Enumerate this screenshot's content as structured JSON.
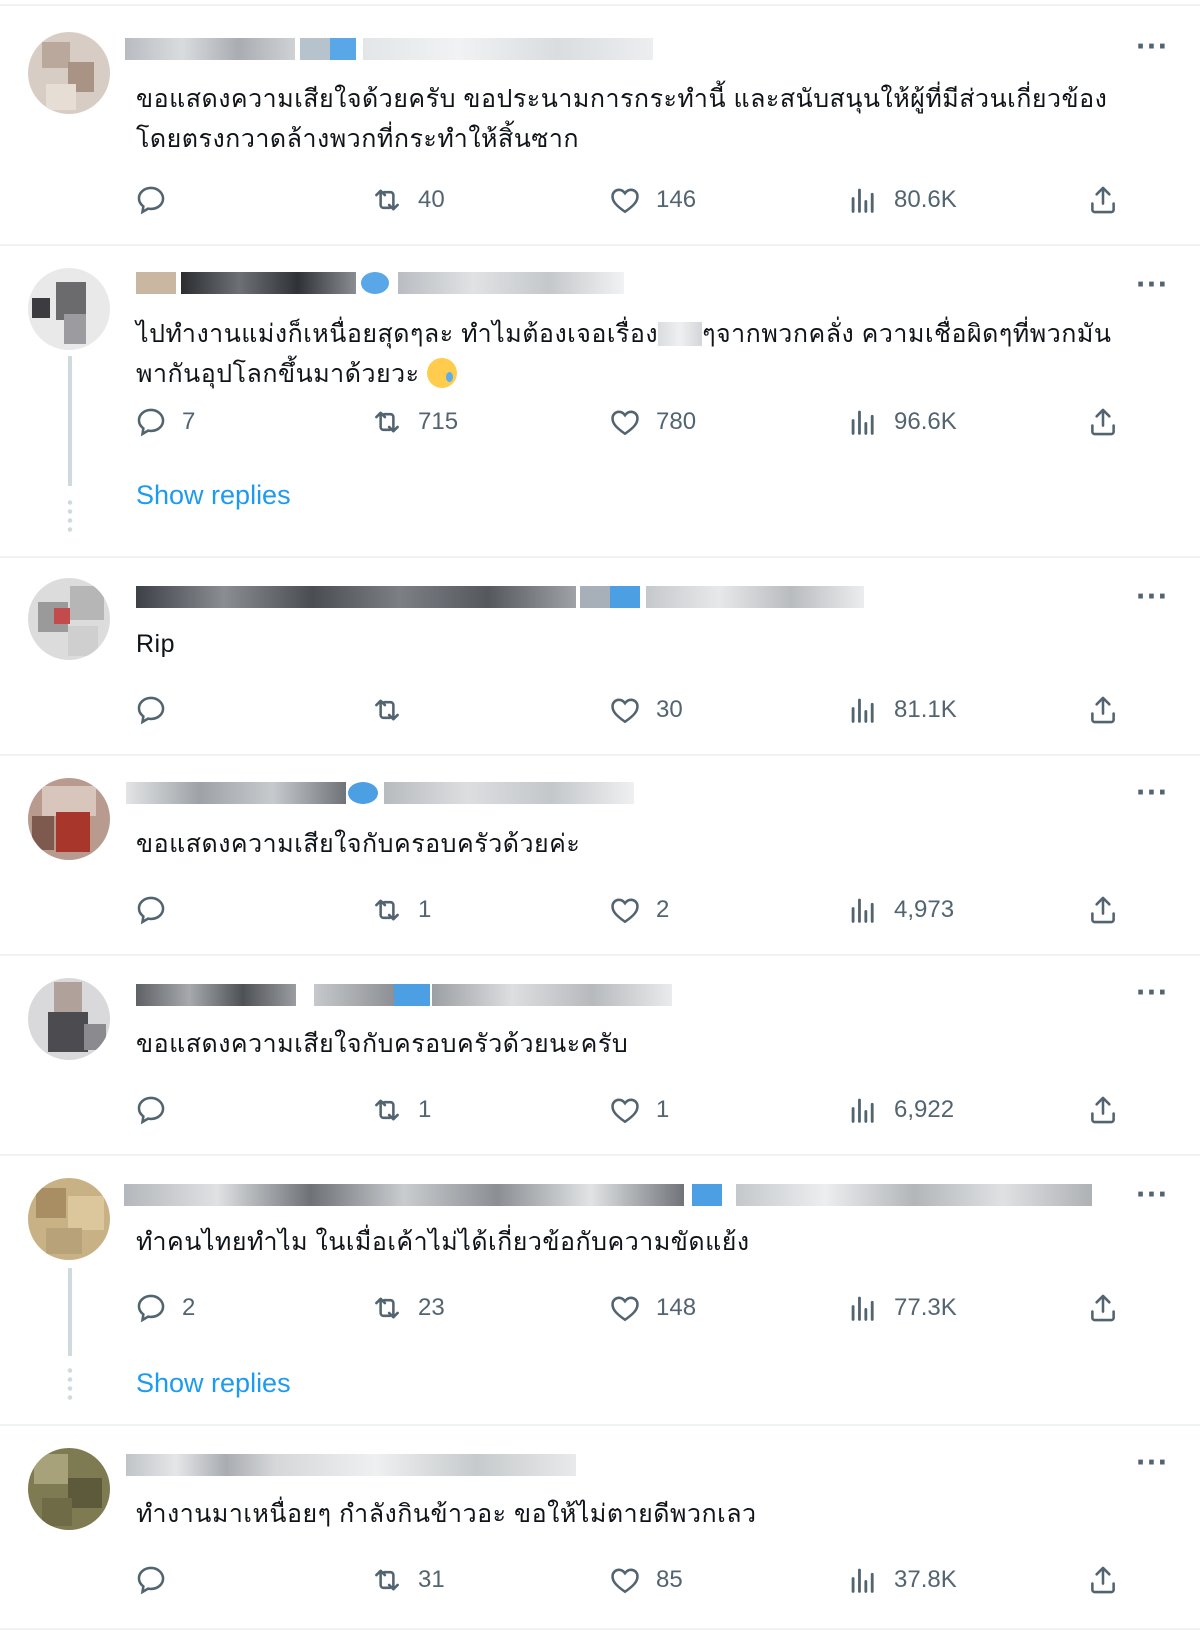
{
  "replies": [
    {
      "text": "ขอแสดงความเสียใจด้วยครับ ขอประนามการกระทำนี้ และสนับสนุนให้ผู้ที่มีส่วนเกี่ยวข้องโดยตรงกวาดล้างพวกที่กระทำให้สิ้นซาก",
      "reply_count": "",
      "repost_count": "40",
      "like_count": "146",
      "view_count": "80.6K",
      "show_replies": ""
    },
    {
      "text_before": "ไปทำงานแม่งก็เหนื่อยสุดๆละ ทำไมต้องเจอเรื่อง",
      "text_after": "ๆจากพวกคลั่ง ความเชื่อผิดๆที่พวกมันพากันอุปโลกขึ้นมาด้วยวะ",
      "reply_count": "7",
      "repost_count": "715",
      "like_count": "780",
      "view_count": "96.6K",
      "show_replies": "Show replies"
    },
    {
      "text": "Rip",
      "reply_count": "",
      "repost_count": "",
      "like_count": "30",
      "view_count": "81.1K",
      "show_replies": ""
    },
    {
      "text": "ขอแสดงความเสียใจกับครอบครัวด้วยค่ะ",
      "reply_count": "",
      "repost_count": "1",
      "like_count": "2",
      "view_count": "4,973",
      "show_replies": ""
    },
    {
      "text": "ขอแสดงความเสียใจกับครอบครัวด้วยนะครับ",
      "reply_count": "",
      "repost_count": "1",
      "like_count": "1",
      "view_count": "6,922",
      "show_replies": ""
    },
    {
      "text": "ทำคนไทยทำไม ในเมื่อเค้าไม่ได้เกี่ยวข้อกับความขัดแย้ง",
      "reply_count": "2",
      "repost_count": "23",
      "like_count": "148",
      "view_count": "77.3K",
      "show_replies": "Show replies"
    },
    {
      "text": "ทำงานมาเหนื่อยๆ กำลังกินข้าวอะ ขอให้ไม่ตายดีพวกเลว",
      "reply_count": "",
      "repost_count": "31",
      "like_count": "85",
      "view_count": "37.8K",
      "show_replies": ""
    }
  ],
  "icons": {
    "more": "more-horizontal-icon",
    "reply": "reply-bubble-icon",
    "repost": "repost-icon",
    "like": "heart-icon",
    "views": "views-bar-chart-icon",
    "share": "share-upload-icon",
    "verified": "verified-badge-icon",
    "emoji": "crying-face-emoji"
  },
  "colors": {
    "link": "#1d9bf0",
    "muted": "#536471",
    "text": "#0f1419",
    "divider": "#eff3f4"
  }
}
